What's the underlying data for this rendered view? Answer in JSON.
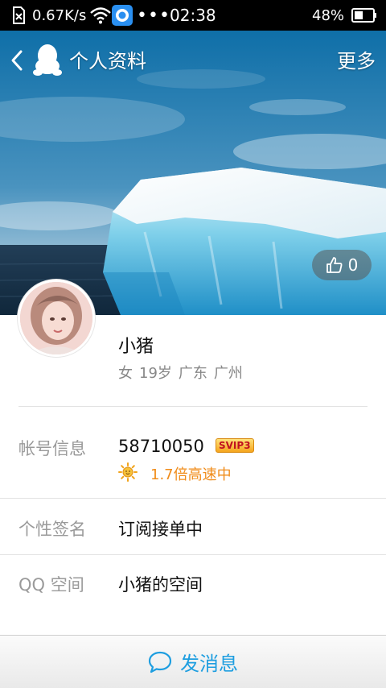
{
  "status_bar": {
    "network_speed": "0.67K/s",
    "time": "02:38",
    "battery": "48%",
    "battery_level": 0.48,
    "overflow_dots": "•••"
  },
  "nav": {
    "title": "个人资料",
    "more": "更多"
  },
  "hero": {
    "like_count": "0"
  },
  "profile": {
    "nickname": "小猪",
    "gender": "女",
    "age": "19岁",
    "province": "广东",
    "city": "广州"
  },
  "account": {
    "label": "帐号信息",
    "qq_number": "58710050",
    "badge": "SVIP3",
    "speed": "1.7倍高速中"
  },
  "signature": {
    "label": "个性签名",
    "value": "订阅接单中"
  },
  "qzone": {
    "label": "QQ 空间",
    "value": "小猪的空间"
  },
  "bottom": {
    "send_message": "发消息"
  },
  "colors": {
    "accent": "#1e9ee0",
    "speed_orange": "#f08c1a",
    "label_gray": "#9a9a9a"
  },
  "icons": [
    "sim-icon",
    "wifi-icon",
    "app-notification-icon",
    "battery-icon",
    "back-chevron-icon",
    "qq-penguin-icon",
    "thumbs-up-icon",
    "sun-icon",
    "chat-bubble-icon"
  ]
}
